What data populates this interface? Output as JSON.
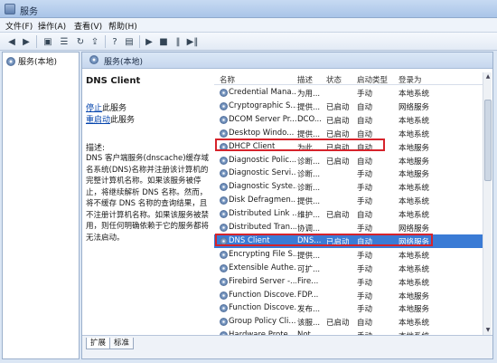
{
  "window": {
    "title": "服务"
  },
  "menu": [
    "文件(F)",
    "操作(A)",
    "查看(V)",
    "帮助(H)"
  ],
  "toolbar": {
    "icons": [
      "back-arrow-icon",
      "forward-arrow-icon",
      "console-tree-icon",
      "list-icon",
      "refresh-icon",
      "export-icon",
      "help-icon",
      "properties-icon",
      "start-icon",
      "stop-icon",
      "pause-icon",
      "restart-icon"
    ]
  },
  "tree": {
    "root": "服务(本地)"
  },
  "main": {
    "header": "服务(本地)",
    "detail": {
      "service_name": "DNS Client",
      "stop_link": "停止",
      "stop_suffix": "此服务",
      "restart_link": "重启动",
      "restart_suffix": "此服务",
      "desc_label": "描述:",
      "description": "DNS 客户端服务(dnscache)缓存域名系统(DNS)名称并注册该计算机的完整计算机名称。如果该服务被停止，将继续解析 DNS 名称。然而，将不缓存 DNS 名称的查询结果，且不注册计算机名称。如果该服务被禁用，则任何明确依赖于它的服务都将无法启动。"
    },
    "columns": [
      "名称",
      "描述",
      "状态",
      "启动类型",
      "登录为"
    ],
    "rows": [
      {
        "name": "Credential Mana...",
        "desc": "为用...",
        "status": "",
        "startup": "手动",
        "logon": "本地系统"
      },
      {
        "name": "Cryptographic S...",
        "desc": "提供...",
        "status": "已启动",
        "startup": "自动",
        "logon": "网络服务"
      },
      {
        "name": "DCOM Server Pr...",
        "desc": "DCO...",
        "status": "已启动",
        "startup": "自动",
        "logon": "本地系统"
      },
      {
        "name": "Desktop Windo...",
        "desc": "提供...",
        "status": "已启动",
        "startup": "自动",
        "logon": "本地系统"
      },
      {
        "name": "DHCP Client",
        "desc": "为此...",
        "status": "已启动",
        "startup": "自动",
        "logon": "本地服务"
      },
      {
        "name": "Diagnostic Polic...",
        "desc": "诊断...",
        "status": "已启动",
        "startup": "自动",
        "logon": "本地服务"
      },
      {
        "name": "Diagnostic Servi...",
        "desc": "诊断...",
        "status": "",
        "startup": "手动",
        "logon": "本地服务"
      },
      {
        "name": "Diagnostic Syste...",
        "desc": "诊断...",
        "status": "",
        "startup": "手动",
        "logon": "本地系统"
      },
      {
        "name": "Disk Defragmen...",
        "desc": "提供...",
        "status": "",
        "startup": "手动",
        "logon": "本地系统"
      },
      {
        "name": "Distributed Link ...",
        "desc": "维护...",
        "status": "已启动",
        "startup": "自动",
        "logon": "本地系统"
      },
      {
        "name": "Distributed Tran...",
        "desc": "协调...",
        "status": "",
        "startup": "手动",
        "logon": "网络服务"
      },
      {
        "name": "DNS Client",
        "desc": "DNS...",
        "status": "已启动",
        "startup": "自动",
        "logon": "网络服务"
      },
      {
        "name": "Encrypting File S...",
        "desc": "提供...",
        "status": "",
        "startup": "手动",
        "logon": "本地系统"
      },
      {
        "name": "Extensible Authe...",
        "desc": "可扩...",
        "status": "",
        "startup": "手动",
        "logon": "本地系统"
      },
      {
        "name": "Firebird Server -...",
        "desc": "Fire...",
        "status": "",
        "startup": "手动",
        "logon": "本地系统"
      },
      {
        "name": "Function Discove...",
        "desc": "FDP...",
        "status": "",
        "startup": "手动",
        "logon": "本地服务"
      },
      {
        "name": "Function Discove...",
        "desc": "发布...",
        "status": "",
        "startup": "手动",
        "logon": "本地服务"
      },
      {
        "name": "Group Policy Cli...",
        "desc": "该服...",
        "status": "已启动",
        "startup": "自动",
        "logon": "本地系统"
      },
      {
        "name": "Hardware Prote...",
        "desc": "Not...",
        "status": "",
        "startup": "手动",
        "logon": "本地系统"
      }
    ],
    "tabs": [
      "扩展",
      "标准"
    ]
  },
  "colors": {
    "selection": "#3a7bd5",
    "highlight_box": "#d6232b",
    "link": "#0645ad"
  }
}
